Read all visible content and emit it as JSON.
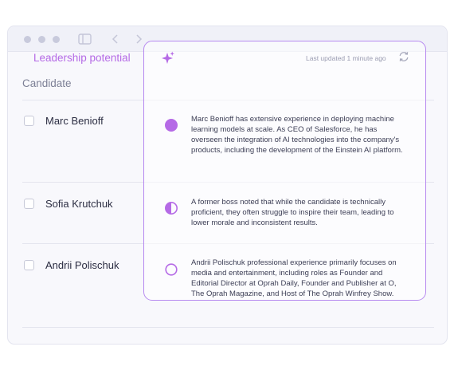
{
  "window": {
    "controls": [
      "circle-icon",
      "circle-icon",
      "circle-icon"
    ],
    "toolbar_icons": [
      "sidebar-toggle-icon",
      "chevron-left-icon",
      "chevron-right-icon"
    ]
  },
  "table": {
    "column_header": "Candidate",
    "panel": {
      "title": "Leadership potential",
      "title_icon": "sparkle-icon",
      "last_updated": "Last updated 1 minute ago",
      "refresh_icon": "refresh-icon",
      "accent_color": "#b56ae6"
    },
    "rows": [
      {
        "name": "Marc Benioff",
        "level": "high",
        "indicator_fill": 1.0,
        "insight": "Marc Benioff has extensive experience in deploying machine learning models at scale. As CEO of Salesforce, he has overseen the integration of AI technologies into the company's products, including the development of the Einstein AI platform."
      },
      {
        "name": "Sofia Krutchuk",
        "level": "medium",
        "indicator_fill": 0.5,
        "insight": "A former boss noted that while the candidate is technically proficient, they often struggle to inspire their team, leading to lower morale and inconsistent results."
      },
      {
        "name": "Andrii Polischuk",
        "level": "low",
        "indicator_fill": 0.0,
        "insight": "Andrii Polischuk professional experience primarily focuses on media and entertainment, including roles as Founder and Editorial Director at Oprah Daily, Founder and Publisher at O, The Oprah Magazine, and Host of The Oprah Winfrey Show."
      }
    ]
  }
}
